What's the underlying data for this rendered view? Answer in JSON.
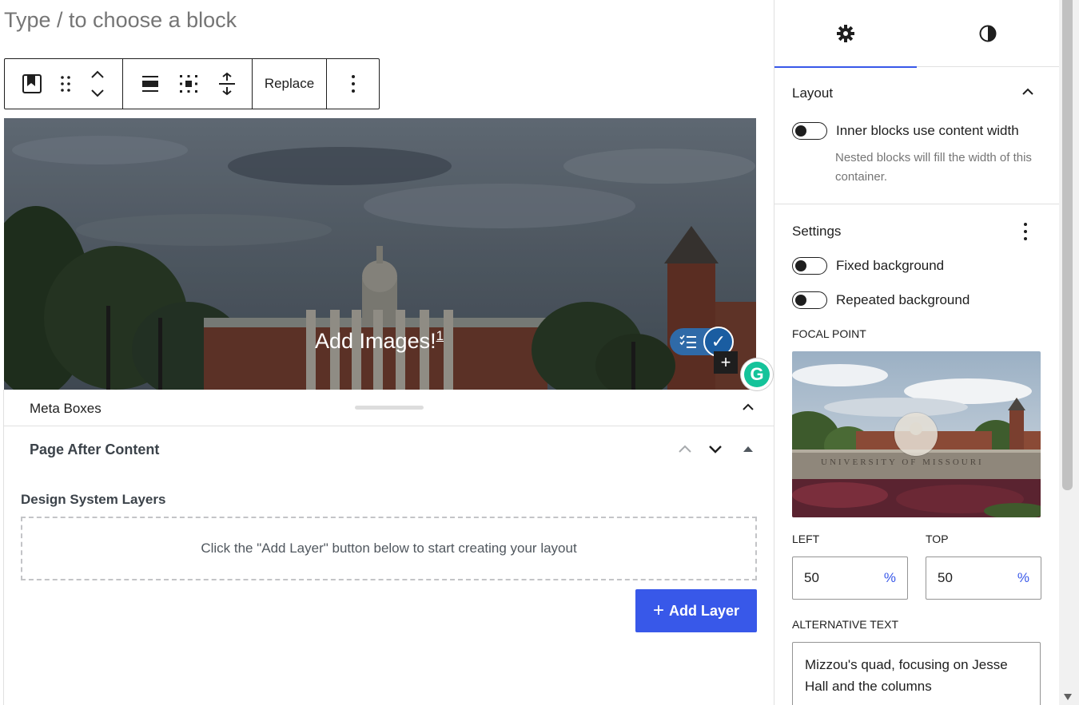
{
  "editor": {
    "placeholder": "Type / to choose a block",
    "toolbar": {
      "block_icon": "cover-block-icon",
      "drag_icon": "drag-handle-icon",
      "move_icon": "move-up-down-icon",
      "align_icon": "align-icon",
      "fullheight_icon": "content-position-icon",
      "height_icon": "full-height-icon",
      "replace_label": "Replace",
      "more_icon": "more-options-icon"
    },
    "cover": {
      "title": "Add Images!",
      "footnote": "1"
    },
    "extensions": {
      "checklist_icon": "checklist-icon",
      "check_icon": "checkmark-icon",
      "plus_label": "+",
      "grammarly_label": "G"
    }
  },
  "meta_boxes": {
    "title": "Meta Boxes",
    "page_after_content": {
      "title": "Page After Content"
    },
    "design_system_layers": {
      "title": "Design System Layers",
      "empty_text": "Click the \"Add Layer\" button below to start creating your layout",
      "add_button_plus": "+",
      "add_button_label": "Add Layer"
    }
  },
  "sidebar": {
    "tabs": [
      {
        "name": "settings",
        "icon": "gear-icon",
        "active": true
      },
      {
        "name": "styles",
        "icon": "contrast-icon",
        "active": false
      }
    ],
    "layout": {
      "title": "Layout",
      "toggle_label": "Inner blocks use content width",
      "help": "Nested blocks will fill the width of this container."
    },
    "settings": {
      "title": "Settings",
      "fixed_bg_label": "Fixed background",
      "repeated_bg_label": "Repeated background",
      "focal_point_label": "FOCAL POINT",
      "left_label": "LEFT",
      "top_label": "TOP",
      "left_value": "50",
      "top_value": "50",
      "unit": "%",
      "alt_label": "ALTERNATIVE TEXT",
      "alt_text": "Mizzou's quad, focusing on Jesse Hall and the columns"
    }
  },
  "colors": {
    "accent": "#3858e9",
    "text": "#1e1e1e",
    "muted": "#757575"
  }
}
